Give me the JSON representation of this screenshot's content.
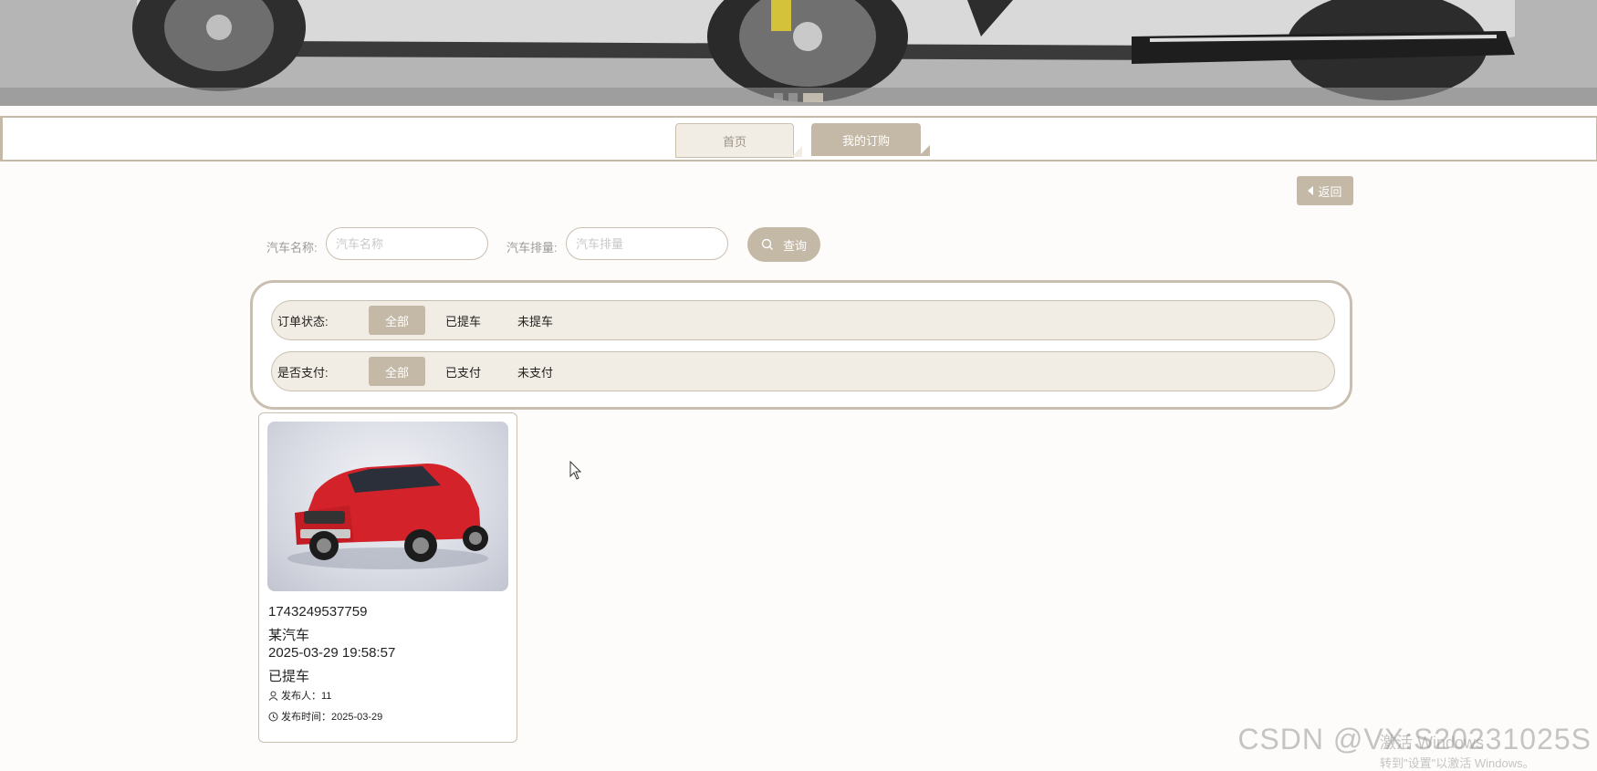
{
  "banner": {
    "slides": 3,
    "active_slide": 3
  },
  "nav": {
    "tabs": [
      {
        "label": "首页",
        "active": false
      },
      {
        "label": "我的订购",
        "active": true
      }
    ]
  },
  "back_button": {
    "label": "返回"
  },
  "search": {
    "car_name_label": "汽车名称:",
    "car_name_placeholder": "汽车名称",
    "displacement_label": "汽车排量:",
    "displacement_placeholder": "汽车排量",
    "query_label": "查询"
  },
  "filters": {
    "order_status": {
      "label": "订单状态:",
      "options": [
        "全部",
        "已提车",
        "未提车"
      ],
      "selected": "全部"
    },
    "paid": {
      "label": "是否支付:",
      "options": [
        "全部",
        "已支付",
        "未支付"
      ],
      "selected": "全部"
    }
  },
  "orders": [
    {
      "order_no": "1743249537759",
      "car_name": "某汽车",
      "datetime": "2025-03-29 19:58:57",
      "status": "已提车",
      "publisher": "发布人：11",
      "publish_time": "发布时间：2025-03-29"
    }
  ],
  "watermark": {
    "csdn": "CSDN @VX:S20231025S",
    "windows_line1": "激活 Windows",
    "windows_line2": "转到\"设置\"以激活 Windows。"
  },
  "colors": {
    "accent": "#c4b8a6",
    "chip_bg": "#f2ede4",
    "border": "#c9bfb0"
  }
}
